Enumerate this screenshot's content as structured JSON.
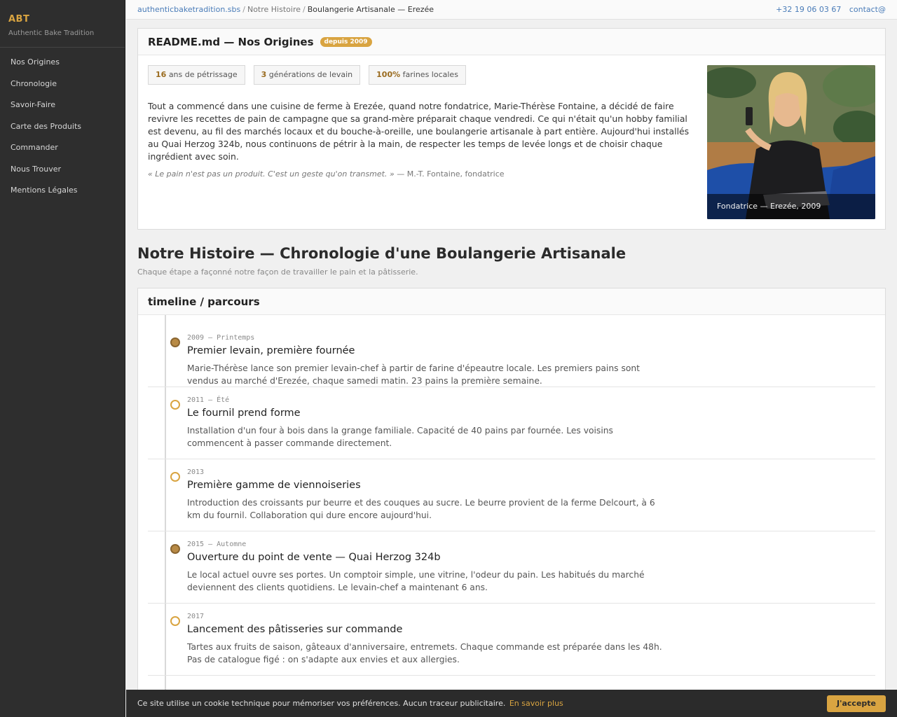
{
  "brand": {
    "name": "ABT",
    "tagline": "Authentic Bake Tradition"
  },
  "nav": [
    {
      "label": "Nos Origines"
    },
    {
      "label": "Chronologie"
    },
    {
      "label": "Savoir-Faire"
    },
    {
      "label": "Carte des Produits"
    },
    {
      "label": "Commander"
    },
    {
      "label": "Nous Trouver"
    },
    {
      "label": "Mentions Légales"
    }
  ],
  "breadcrumb": {
    "site": "authenticbaketradition.sbs",
    "section": "Notre Histoire",
    "current": "Boulangerie Artisanale — Erezée"
  },
  "contact": {
    "phone": "+32 19 06 03 67",
    "email": "contact@"
  },
  "readme": {
    "title": "README.md — Nos Origines",
    "badge": "depuis 2009",
    "stats": [
      {
        "value": "16",
        "label": "ans de pétrissage"
      },
      {
        "value": "3",
        "label": "générations de levain"
      },
      {
        "value": "100%",
        "label": "farines locales"
      }
    ],
    "text": "Tout a commencé dans une cuisine de ferme à Erezée, quand notre fondatrice, Marie-Thérèse Fontaine, a décidé de faire revivre les recettes de pain de campagne que sa grand-mère préparait chaque vendredi. Ce qui n'était qu'un hobby familial est devenu, au fil des marchés locaux et du bouche-à-oreille, une boulangerie artisanale à part entière. Aujourd'hui installés au Quai Herzog 324b, nous continuons de pétrir à la main, de respecter les temps de levée longs et de choisir chaque ingrédient avec soin.",
    "quote": "« Le pain n'est pas un produit. C'est un geste qu'on transmet. »",
    "quote_author": "— M.-T. Fontaine, fondatrice",
    "photo_caption": "Fondatrice — Erezée, 2009"
  },
  "history": {
    "title": "Notre Histoire — Chronologie d'une Boulangerie Artisanale",
    "subtitle": "Chaque étape a façonné notre façon de travailler le pain et la pâtisserie."
  },
  "timeline": {
    "header": "timeline / parcours",
    "items": [
      {
        "date": "2009 — Printemps",
        "title": "Premier levain, première fournée",
        "desc": "Marie-Thérèse lance son premier levain-chef à partir de farine d'épeautre locale. Les premiers pains sont vendus au marché d'Erezée, chaque samedi matin. 23 pains la première semaine.",
        "filled": true
      },
      {
        "date": "2011 — Été",
        "title": "Le fournil prend forme",
        "desc": "Installation d'un four à bois dans la grange familiale. Capacité de 40 pains par fournée. Les voisins commencent à passer commande directement.",
        "filled": false
      },
      {
        "date": "2013",
        "title": "Première gamme de viennoiseries",
        "desc": "Introduction des croissants pur beurre et des couques au sucre. Le beurre provient de la ferme Delcourt, à 6 km du fournil. Collaboration qui dure encore aujourd'hui.",
        "filled": false
      },
      {
        "date": "2015 — Automne",
        "title": "Ouverture du point de vente — Quai Herzog 324b",
        "desc": "Le local actuel ouvre ses portes. Un comptoir simple, une vitrine, l'odeur du pain. Les habitués du marché deviennent des clients quotidiens. Le levain-chef a maintenant 6 ans.",
        "filled": true
      },
      {
        "date": "2017",
        "title": "Lancement des pâtisseries sur commande",
        "desc": "Tartes aux fruits de saison, gâteaux d'anniversaire, entremets. Chaque commande est préparée dans les 48h. Pas de catalogue figé : on s'adapte aux envies et aux allergies.",
        "filled": false
      }
    ]
  },
  "cookie": {
    "text": "Ce site utilise un cookie technique pour mémoriser vos préférences. Aucun traceur publicitaire.",
    "link": "En savoir plus",
    "accept": "J'accepte"
  }
}
